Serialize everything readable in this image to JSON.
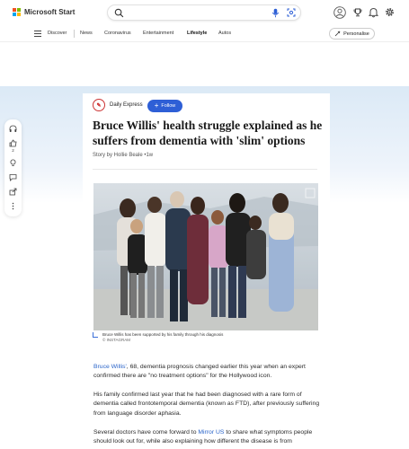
{
  "brand": {
    "name": "Microsoft Start",
    "logo_colors": [
      "#f25022",
      "#7fba00",
      "#00a4ef",
      "#ffb900"
    ],
    "accent": "#2e5fd6"
  },
  "search": {
    "placeholder": ""
  },
  "topbar_icons": [
    "avatar-icon",
    "trophy-icon",
    "bell-icon",
    "settings-icon"
  ],
  "nav": {
    "items": [
      "Discover",
      "News",
      "Coronavirus",
      "Entertainment",
      "Lifestyle",
      "Autos"
    ],
    "active": "Lifestyle",
    "personalise_label": "Personalise"
  },
  "rail": {
    "like_count": "2"
  },
  "article": {
    "source_name": "Daily Express",
    "follow_label": "Follow",
    "headline": "Bruce Willis' health struggle explained as he suffers from dementia with 'slim' options",
    "byline": "Story by Hollie Beale •1w",
    "caption": "Bruce Willis has been supported by his family through his diagnosis",
    "credit": "© INSTAGRAM",
    "p1_link": "Bruce Willis'",
    "p1_rest": ", 68, dementia prognosis changed earlier this year when an expert confirmed there are \"no treatment options\" for the Hollywood icon.",
    "p2": "His family confirmed last year that he had been diagnosed with a rare form of dementia called frontotemporal dementia (known as FTD), after previously suffering from language disorder aphasia.",
    "p3_start": "Several doctors have come forward to ",
    "p3_link": "Mirror US",
    "p3_rest": " to share what symptoms people should look out for, while also explaining how different the disease is from"
  }
}
